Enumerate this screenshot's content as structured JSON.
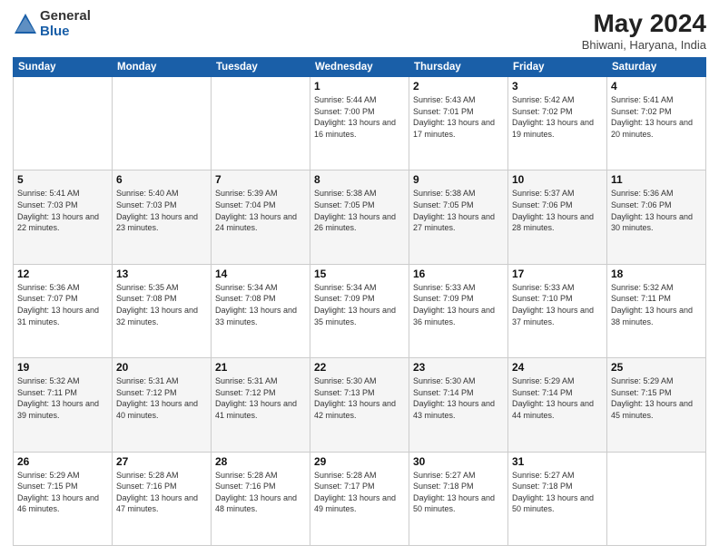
{
  "header": {
    "logo_general": "General",
    "logo_blue": "Blue",
    "title": "May 2024",
    "subtitle": "Bhiwani, Haryana, India"
  },
  "days_of_week": [
    "Sunday",
    "Monday",
    "Tuesday",
    "Wednesday",
    "Thursday",
    "Friday",
    "Saturday"
  ],
  "weeks": [
    [
      {
        "day": "",
        "info": ""
      },
      {
        "day": "",
        "info": ""
      },
      {
        "day": "",
        "info": ""
      },
      {
        "day": "1",
        "info": "Sunrise: 5:44 AM\nSunset: 7:00 PM\nDaylight: 13 hours and 16 minutes."
      },
      {
        "day": "2",
        "info": "Sunrise: 5:43 AM\nSunset: 7:01 PM\nDaylight: 13 hours and 17 minutes."
      },
      {
        "day": "3",
        "info": "Sunrise: 5:42 AM\nSunset: 7:02 PM\nDaylight: 13 hours and 19 minutes."
      },
      {
        "day": "4",
        "info": "Sunrise: 5:41 AM\nSunset: 7:02 PM\nDaylight: 13 hours and 20 minutes."
      }
    ],
    [
      {
        "day": "5",
        "info": "Sunrise: 5:41 AM\nSunset: 7:03 PM\nDaylight: 13 hours and 22 minutes."
      },
      {
        "day": "6",
        "info": "Sunrise: 5:40 AM\nSunset: 7:03 PM\nDaylight: 13 hours and 23 minutes."
      },
      {
        "day": "7",
        "info": "Sunrise: 5:39 AM\nSunset: 7:04 PM\nDaylight: 13 hours and 24 minutes."
      },
      {
        "day": "8",
        "info": "Sunrise: 5:38 AM\nSunset: 7:05 PM\nDaylight: 13 hours and 26 minutes."
      },
      {
        "day": "9",
        "info": "Sunrise: 5:38 AM\nSunset: 7:05 PM\nDaylight: 13 hours and 27 minutes."
      },
      {
        "day": "10",
        "info": "Sunrise: 5:37 AM\nSunset: 7:06 PM\nDaylight: 13 hours and 28 minutes."
      },
      {
        "day": "11",
        "info": "Sunrise: 5:36 AM\nSunset: 7:06 PM\nDaylight: 13 hours and 30 minutes."
      }
    ],
    [
      {
        "day": "12",
        "info": "Sunrise: 5:36 AM\nSunset: 7:07 PM\nDaylight: 13 hours and 31 minutes."
      },
      {
        "day": "13",
        "info": "Sunrise: 5:35 AM\nSunset: 7:08 PM\nDaylight: 13 hours and 32 minutes."
      },
      {
        "day": "14",
        "info": "Sunrise: 5:34 AM\nSunset: 7:08 PM\nDaylight: 13 hours and 33 minutes."
      },
      {
        "day": "15",
        "info": "Sunrise: 5:34 AM\nSunset: 7:09 PM\nDaylight: 13 hours and 35 minutes."
      },
      {
        "day": "16",
        "info": "Sunrise: 5:33 AM\nSunset: 7:09 PM\nDaylight: 13 hours and 36 minutes."
      },
      {
        "day": "17",
        "info": "Sunrise: 5:33 AM\nSunset: 7:10 PM\nDaylight: 13 hours and 37 minutes."
      },
      {
        "day": "18",
        "info": "Sunrise: 5:32 AM\nSunset: 7:11 PM\nDaylight: 13 hours and 38 minutes."
      }
    ],
    [
      {
        "day": "19",
        "info": "Sunrise: 5:32 AM\nSunset: 7:11 PM\nDaylight: 13 hours and 39 minutes."
      },
      {
        "day": "20",
        "info": "Sunrise: 5:31 AM\nSunset: 7:12 PM\nDaylight: 13 hours and 40 minutes."
      },
      {
        "day": "21",
        "info": "Sunrise: 5:31 AM\nSunset: 7:12 PM\nDaylight: 13 hours and 41 minutes."
      },
      {
        "day": "22",
        "info": "Sunrise: 5:30 AM\nSunset: 7:13 PM\nDaylight: 13 hours and 42 minutes."
      },
      {
        "day": "23",
        "info": "Sunrise: 5:30 AM\nSunset: 7:14 PM\nDaylight: 13 hours and 43 minutes."
      },
      {
        "day": "24",
        "info": "Sunrise: 5:29 AM\nSunset: 7:14 PM\nDaylight: 13 hours and 44 minutes."
      },
      {
        "day": "25",
        "info": "Sunrise: 5:29 AM\nSunset: 7:15 PM\nDaylight: 13 hours and 45 minutes."
      }
    ],
    [
      {
        "day": "26",
        "info": "Sunrise: 5:29 AM\nSunset: 7:15 PM\nDaylight: 13 hours and 46 minutes."
      },
      {
        "day": "27",
        "info": "Sunrise: 5:28 AM\nSunset: 7:16 PM\nDaylight: 13 hours and 47 minutes."
      },
      {
        "day": "28",
        "info": "Sunrise: 5:28 AM\nSunset: 7:16 PM\nDaylight: 13 hours and 48 minutes."
      },
      {
        "day": "29",
        "info": "Sunrise: 5:28 AM\nSunset: 7:17 PM\nDaylight: 13 hours and 49 minutes."
      },
      {
        "day": "30",
        "info": "Sunrise: 5:27 AM\nSunset: 7:18 PM\nDaylight: 13 hours and 50 minutes."
      },
      {
        "day": "31",
        "info": "Sunrise: 5:27 AM\nSunset: 7:18 PM\nDaylight: 13 hours and 50 minutes."
      },
      {
        "day": "",
        "info": ""
      }
    ]
  ]
}
